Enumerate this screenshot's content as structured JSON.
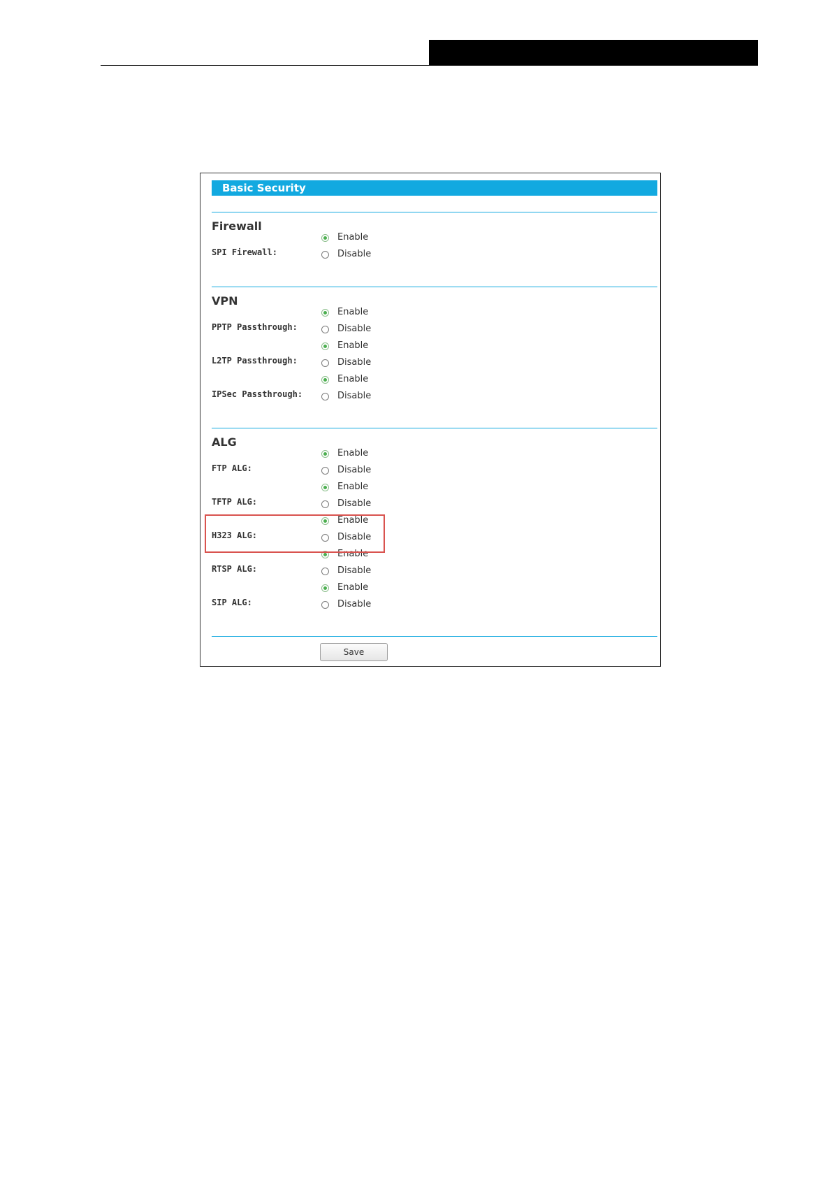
{
  "panel": {
    "title": "Basic Security",
    "save_label": "Save"
  },
  "sections": {
    "firewall": {
      "title": "Firewall",
      "spi_firewall": {
        "label": "SPI Firewall:",
        "value": "Enable"
      }
    },
    "vpn": {
      "title": "VPN",
      "pptp": {
        "label": "PPTP Passthrough:",
        "value": "Enable"
      },
      "l2tp": {
        "label": "L2TP Passthrough:",
        "value": "Enable"
      },
      "ipsec": {
        "label": "IPSec Passthrough:",
        "value": "Enable"
      }
    },
    "alg": {
      "title": "ALG",
      "ftp": {
        "label": "FTP ALG:",
        "value": "Enable"
      },
      "tftp": {
        "label": "TFTP ALG:",
        "value": "Enable"
      },
      "h323": {
        "label": "H323 ALG:",
        "value": "Enable"
      },
      "rtsp": {
        "label": "RTSP ALG:",
        "value": "Enable"
      },
      "sip": {
        "label": "SIP ALG:",
        "value": "Enable"
      }
    }
  },
  "options": {
    "enable": "Enable",
    "disable": "Disable"
  },
  "colors": {
    "accent": "#12a9e0",
    "highlight": "#d9534f",
    "radio_selected": "#4caf50"
  }
}
